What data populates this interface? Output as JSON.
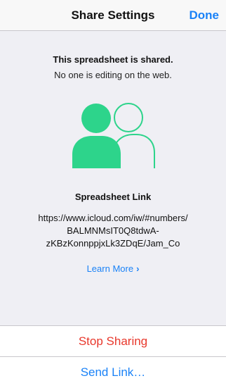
{
  "navbar": {
    "title": "Share Settings",
    "done_label": "Done"
  },
  "status": {
    "headline": "This spreadsheet is shared.",
    "subtext": "No one is editing on the web."
  },
  "link": {
    "heading": "Spreadsheet Link",
    "url_lines": [
      "https://www.icloud.com/iw/#numbers/",
      "BALMNMsIT0Q8tdwA-",
      "zKBzKonnppjxLk3ZDqE/Jam_Co"
    ],
    "learn_more_label": "Learn More",
    "learn_more_chevron": "›"
  },
  "actions": {
    "stop_label": "Stop Sharing",
    "send_label": "Send Link…"
  },
  "icons": {
    "people": "people-shared-icon"
  },
  "colors": {
    "accent": "#1a82f7",
    "destructive": "#e8372b",
    "people_green": "#2dd48b",
    "background": "#efeff4"
  }
}
